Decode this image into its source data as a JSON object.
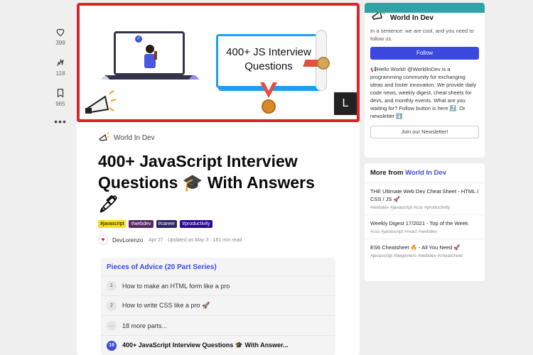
{
  "reactions": [
    {
      "icon": "heart-icon",
      "count": "399"
    },
    {
      "icon": "unicorn-icon",
      "count": "118"
    },
    {
      "icon": "bookmark-icon",
      "count": "965"
    }
  ],
  "more_label": "•••",
  "cover": {
    "cert_line1": "400+ JS Interview",
    "cert_line2": "Questions",
    "logo_letter": "L",
    "check": "✓"
  },
  "article": {
    "org": "World In Dev",
    "title": "400+ JavaScript Interview Questions 🎓 With Answers 🖋",
    "tags": [
      {
        "label": "#javascript",
        "color": "#f7df1e",
        "text_color": "#000"
      },
      {
        "label": "#webdev",
        "color": "#562765",
        "text_color": "#fff"
      },
      {
        "label": "#career",
        "color": "#2a2566",
        "text_color": "#fff"
      },
      {
        "label": "#productivity",
        "color": "#2a0798",
        "text_color": "#fff"
      }
    ],
    "author": "DevLorenzo",
    "date": "Apr 27",
    "updated": "Updated on May 3",
    "read_time": "181 min read"
  },
  "series": {
    "title": "Pieces of Advice (20 Part Series)",
    "items": [
      {
        "num": "1",
        "label": "How to make an HTML form like a pro"
      },
      {
        "num": "2",
        "label": "How to write CSS like a pro 🚀"
      },
      {
        "num": "...",
        "label": "18 more parts..."
      },
      {
        "num": "19",
        "label": "400+ JavaScript Interview Questions 🎓 With Answer..."
      }
    ]
  },
  "sidebar": {
    "org_name": "World In Dev",
    "summary": "In a sentence: we are cool, and you need to follow us.",
    "follow": "Follow",
    "description": "📢Hello World! @WorldInDev is a programming community for exchanging ideas and foster innovation. We provide daily code news, weekly digest, cheat sheets for devs, and monthly events. What are you waiting for? Follow button is here ⤴️. Or newsletter ⬇️",
    "newsletter": "Join our Newsletter!",
    "more_prefix": "More from",
    "more_org": "World In Dev",
    "posts": [
      {
        "title": "THE Ultimate Web Dev Cheat Sheet - HTML / CSS / JS 🚀",
        "tags": "#webdev  #javascript  #css  #productivity"
      },
      {
        "title": "Weekly Digest 17/2021 - Top of the Week",
        "tags": "#css  #javascript  #react  #webdev"
      },
      {
        "title": "ES6 Cheatsheet 🔥 - All You Need 🚀",
        "tags": "#javascript  #beginners  #webdev  #cheatsheet"
      }
    ]
  },
  "colors": {
    "accent": "#3b49df",
    "cover_border": "#d8262c",
    "org_bar": "#2ba6a6"
  }
}
